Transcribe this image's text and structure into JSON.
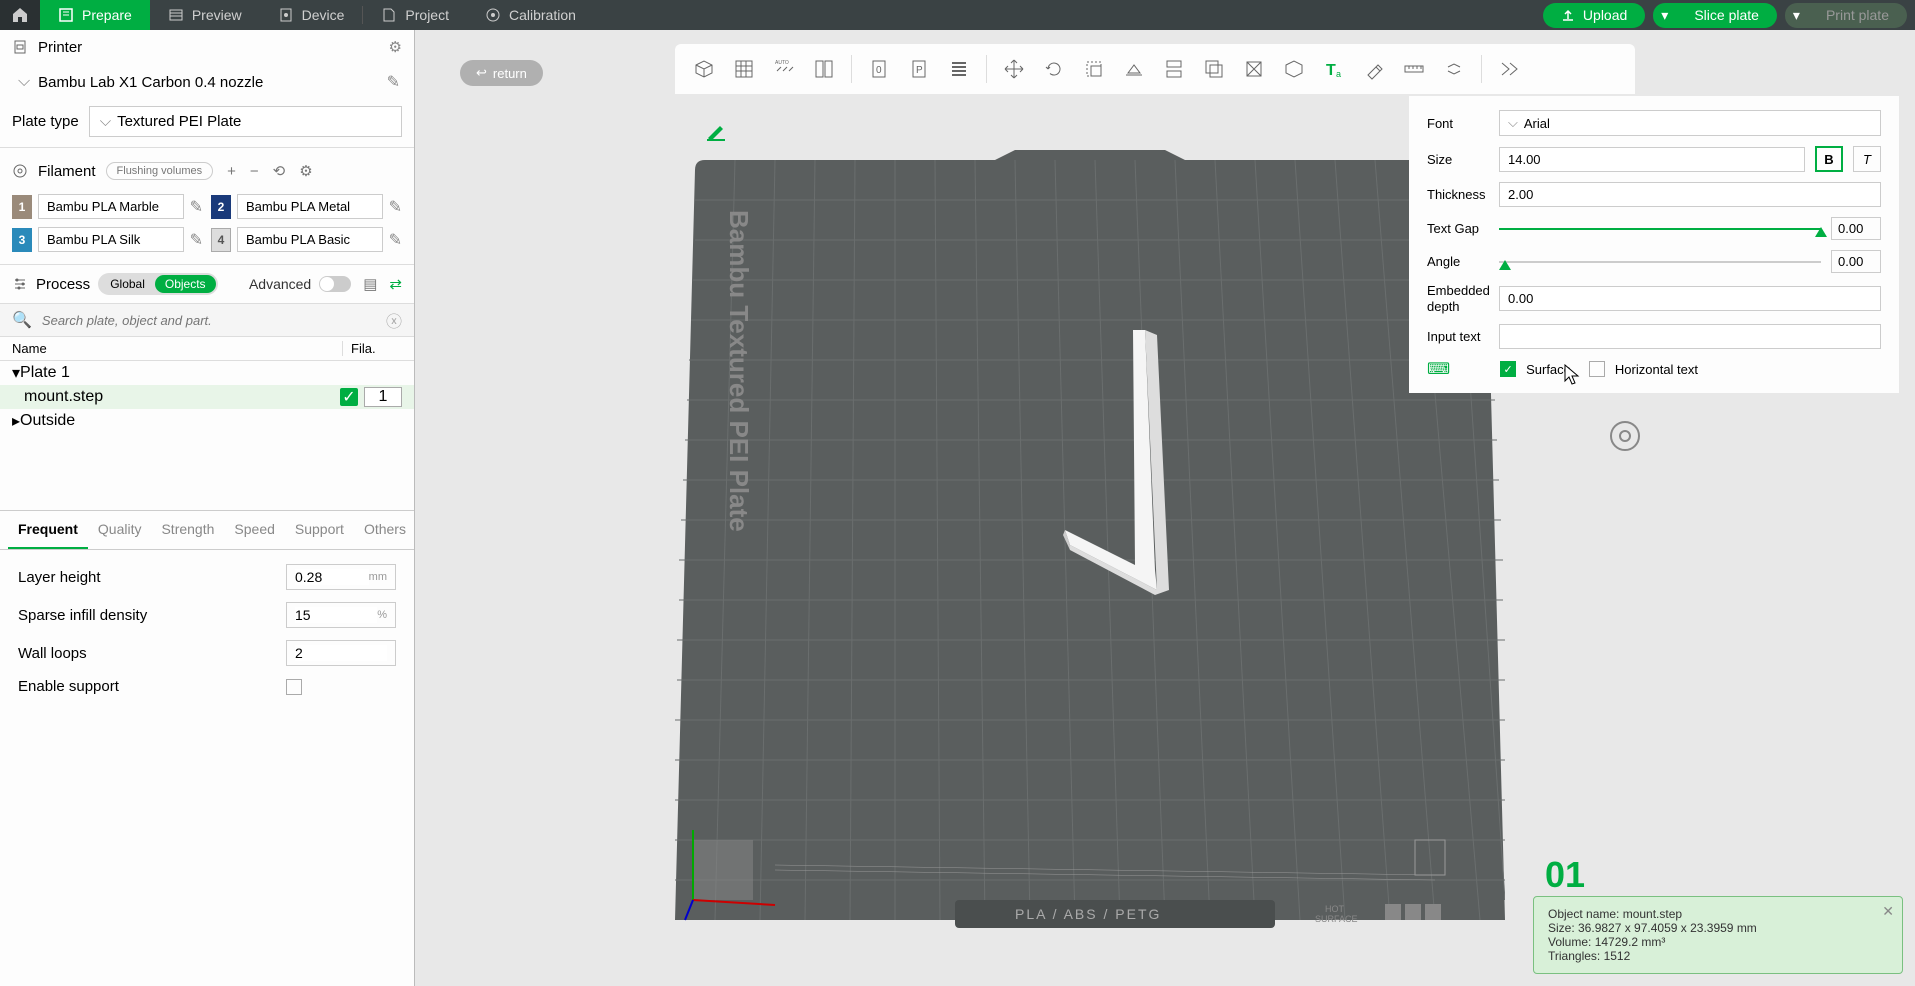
{
  "topbar": {
    "tabs": [
      "Prepare",
      "Preview",
      "Device",
      "Project",
      "Calibration"
    ],
    "upload": "Upload",
    "slice": "Slice plate",
    "print": "Print plate"
  },
  "printer": {
    "header": "Printer",
    "name": "Bambu Lab X1 Carbon 0.4 nozzle",
    "plate_type_label": "Plate type",
    "plate_type": "Textured PEI Plate"
  },
  "filament": {
    "header": "Filament",
    "flushing": "Flushing volumes",
    "items": [
      "Bambu PLA Marble",
      "Bambu PLA Metal",
      "Bambu PLA Silk",
      "Bambu PLA Basic"
    ]
  },
  "process": {
    "header": "Process",
    "global": "Global",
    "objects": "Objects",
    "advanced": "Advanced",
    "search_placeholder": "Search plate, object and part.",
    "col_name": "Name",
    "col_fila": "Fila.",
    "plate1": "Plate 1",
    "mount": "mount.step",
    "mount_fila": "1",
    "outside": "Outside"
  },
  "settings": {
    "tabs": [
      "Frequent",
      "Quality",
      "Strength",
      "Speed",
      "Support",
      "Others"
    ],
    "layer_height_label": "Layer height",
    "layer_height": "0.28",
    "layer_height_unit": "mm",
    "infill_label": "Sparse infill density",
    "infill": "15",
    "infill_unit": "%",
    "wall_label": "Wall loops",
    "wall": "2",
    "support_label": "Enable support"
  },
  "return_btn": "return",
  "text_panel": {
    "font_label": "Font",
    "font": "Arial",
    "size_label": "Size",
    "size": "14.00",
    "thickness_label": "Thickness",
    "thickness": "2.00",
    "gap_label": "Text Gap",
    "gap": "0.00",
    "angle_label": "Angle",
    "angle": "0.00",
    "depth_label": "Embedded depth",
    "depth": "0.00",
    "input_label": "Input text",
    "surface": "Surface",
    "horizontal": "Horizontal text"
  },
  "plate_text": "Bambu Textured PEI Plate",
  "plate_bottom": "PLA / ABS / PETG",
  "plate_num": "01",
  "info": {
    "l1": "Object name: mount.step",
    "l2": "Size: 36.9827 x 97.4059 x 23.3959 mm",
    "l3": "Volume: 14729.2 mm³",
    "l4": "Triangles: 1512"
  }
}
